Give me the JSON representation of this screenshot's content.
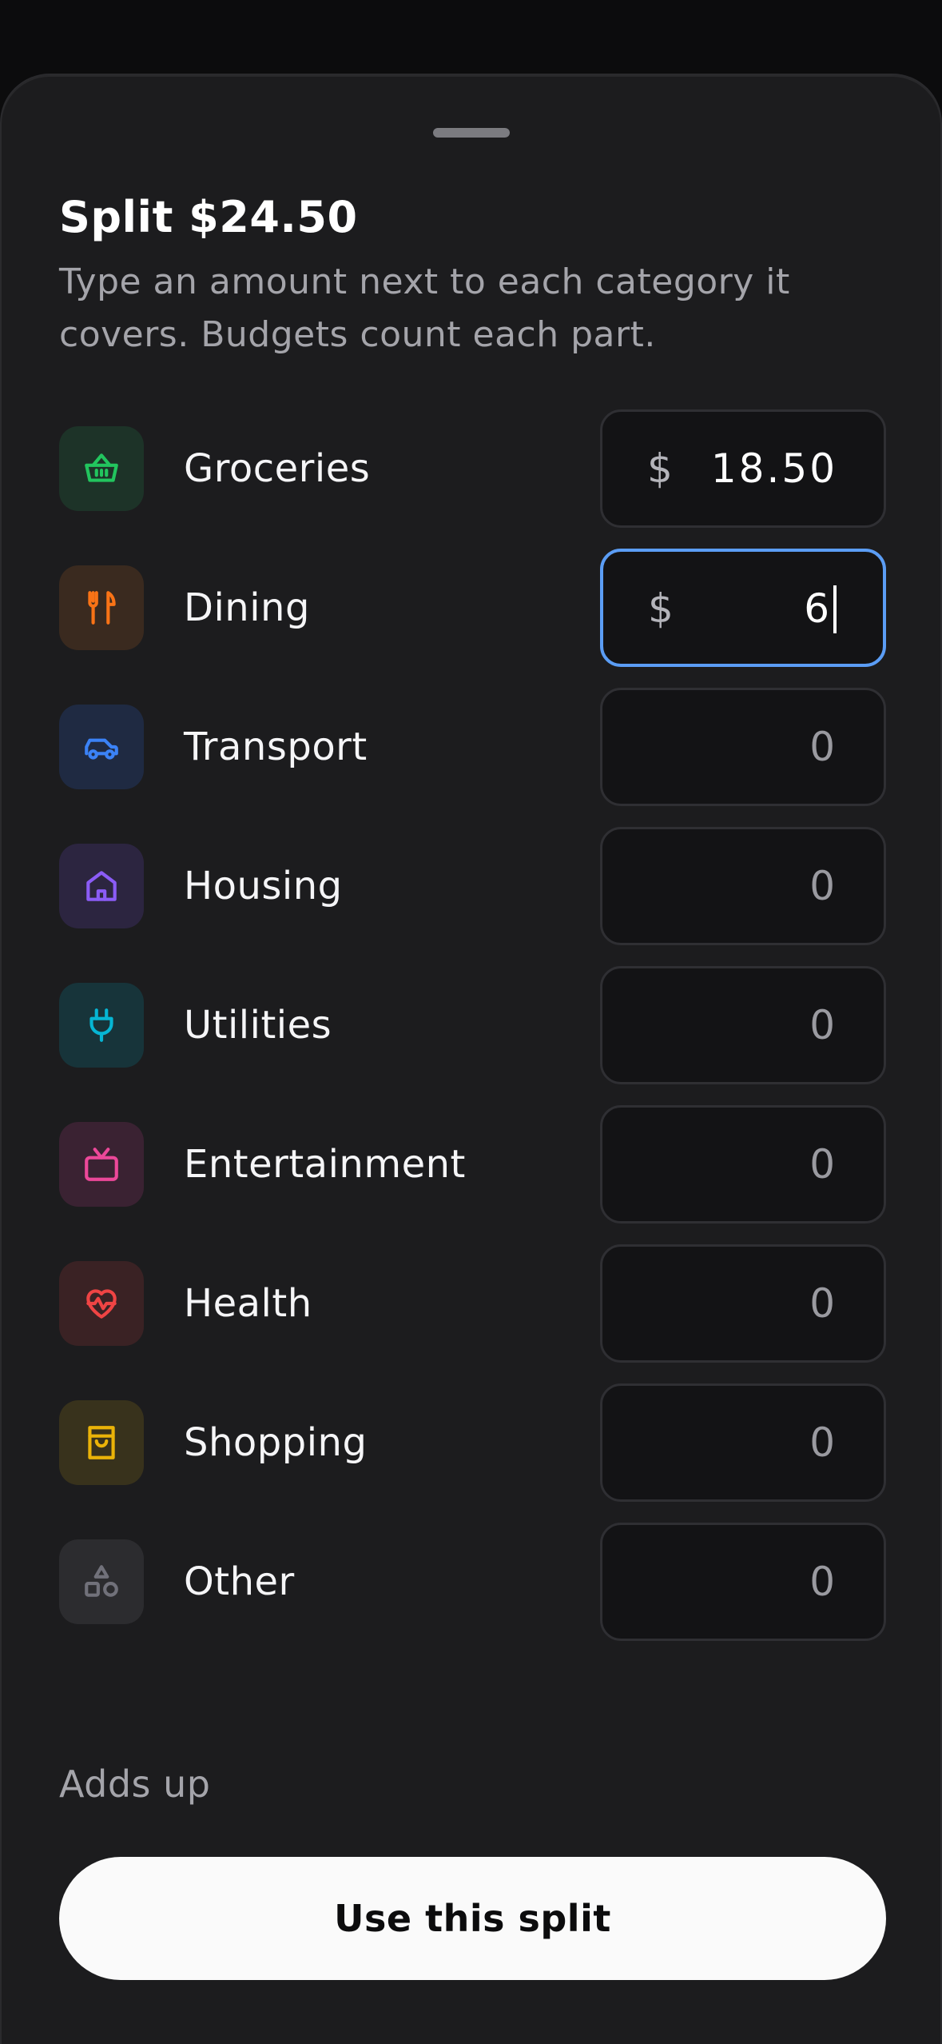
{
  "sheet": {
    "title": "Split $24.50",
    "subtitle": "Type an amount next to each category it covers. Budgets count each part."
  },
  "currency_symbol": "$",
  "categories": [
    {
      "label": "Groceries",
      "value": "18.50",
      "icon": "basket-icon",
      "color": "#22c55e",
      "tile": "#1d3328",
      "show_currency": true,
      "focused": false
    },
    {
      "label": "Dining",
      "value": "6",
      "icon": "utensils-icon",
      "color": "#f97316",
      "tile": "#3a2a1f",
      "show_currency": true,
      "focused": true
    },
    {
      "label": "Transport",
      "value": "0",
      "icon": "car-icon",
      "color": "#3b82f6",
      "tile": "#1f2a42",
      "show_currency": false,
      "focused": false
    },
    {
      "label": "Housing",
      "value": "0",
      "icon": "house-icon",
      "color": "#8b5cf6",
      "tile": "#2c2540",
      "show_currency": false,
      "focused": false
    },
    {
      "label": "Utilities",
      "value": "0",
      "icon": "plug-icon",
      "color": "#06b6d4",
      "tile": "#17343a",
      "show_currency": false,
      "focused": false
    },
    {
      "label": "Entertainment",
      "value": "0",
      "icon": "tv-icon",
      "color": "#ec4899",
      "tile": "#3a2232",
      "show_currency": false,
      "focused": false
    },
    {
      "label": "Health",
      "value": "0",
      "icon": "heart-pulse-icon",
      "color": "#ef4444",
      "tile": "#3a2224",
      "show_currency": false,
      "focused": false
    },
    {
      "label": "Shopping",
      "value": "0",
      "icon": "shopping-bag-icon",
      "color": "#eab308",
      "tile": "#38321c",
      "show_currency": false,
      "focused": false
    },
    {
      "label": "Other",
      "value": "0",
      "icon": "shapes-icon",
      "color": "#71717a",
      "tile": "#2c2c2f",
      "show_currency": false,
      "focused": false
    }
  ],
  "status_text": "Adds up",
  "primary_button": "Use this split"
}
